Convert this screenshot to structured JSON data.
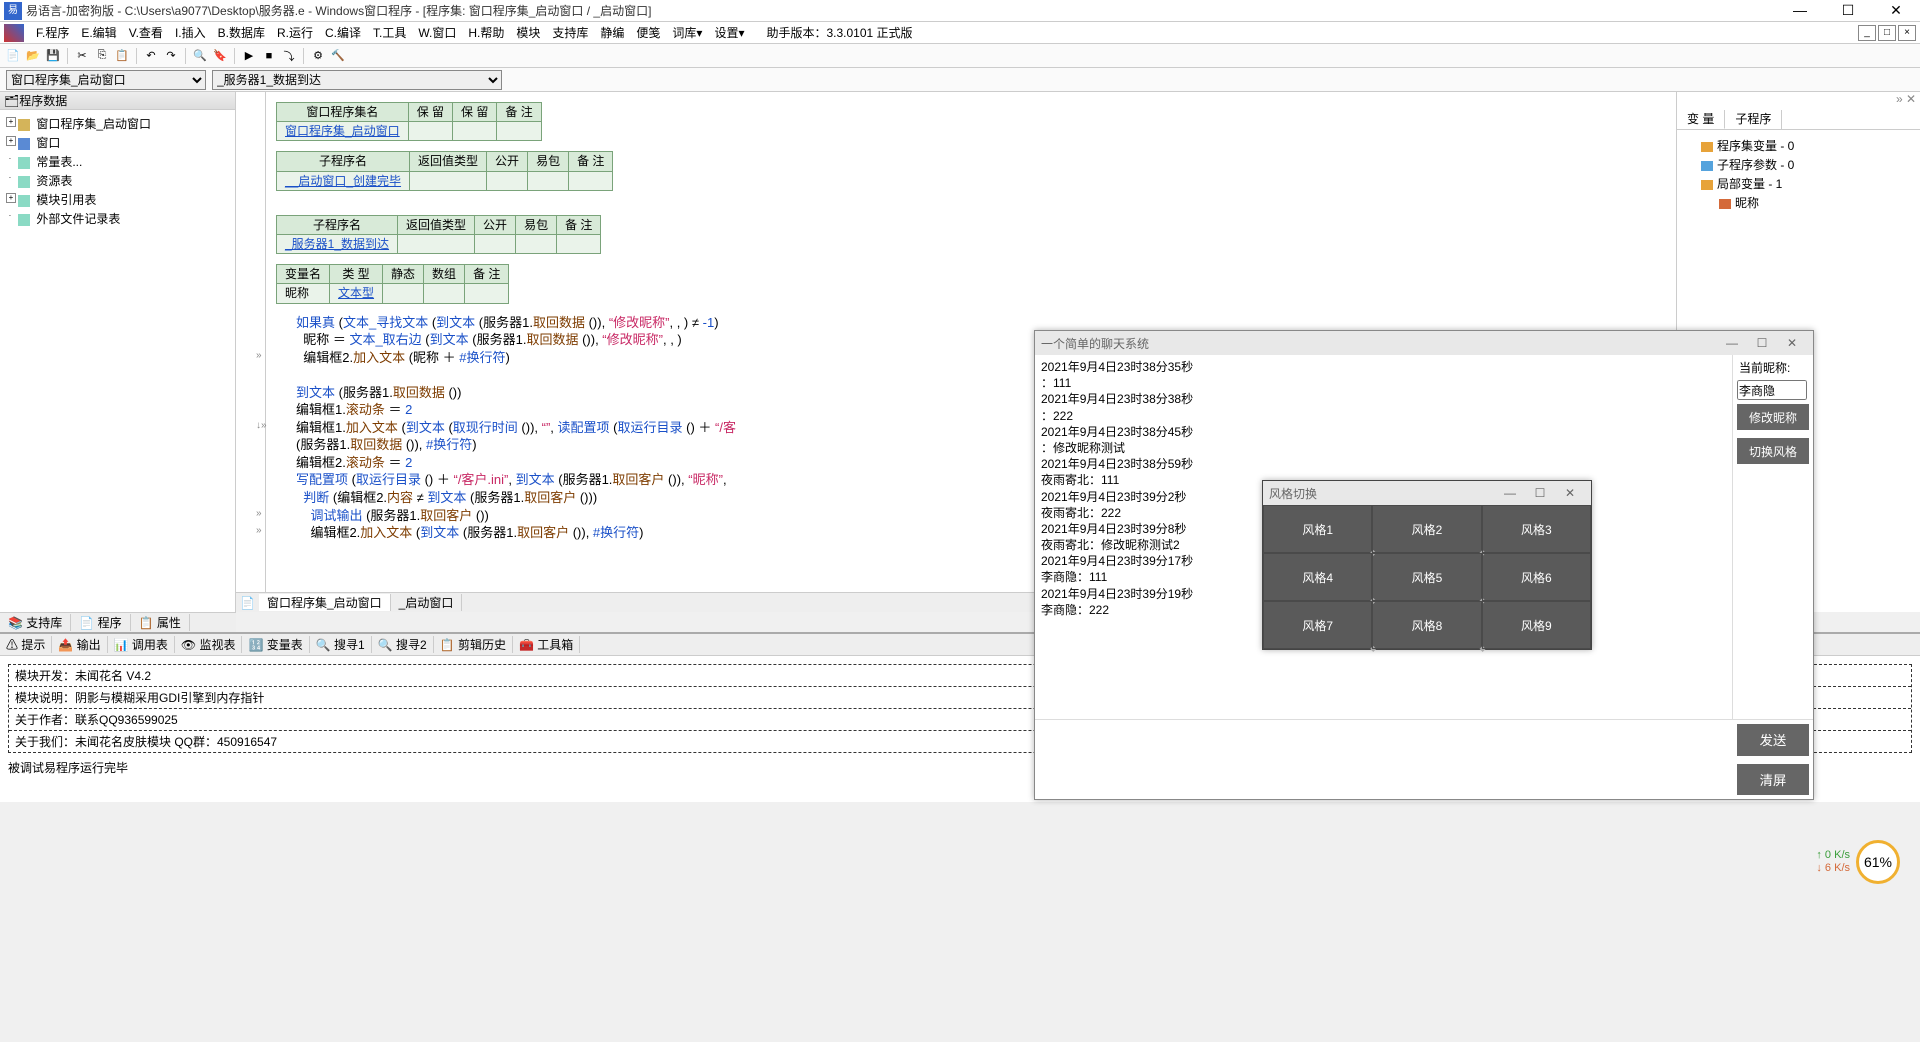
{
  "titlebar": {
    "text": "易语言-加密狗版 - C:\\Users\\a9077\\Desktop\\服务器.e - Windows窗口程序 - [程序集: 窗口程序集_启动窗口 / _启动窗口]"
  },
  "menu": {
    "items": [
      "F.程序",
      "E.编辑",
      "V.查看",
      "I.插入",
      "B.数据库",
      "R.运行",
      "C.编译",
      "T.工具",
      "W.窗口",
      "H.帮助",
      "模块",
      "支持库",
      "静编",
      "便笺",
      "词库▾",
      "设置▾"
    ],
    "helper": "助手版本：3.3.0101 正式版"
  },
  "dropdowns": {
    "d1": "窗口程序集_启动窗口",
    "d2": "_服务器1_数据到达"
  },
  "tree": {
    "title": "程序数据",
    "nodes": [
      {
        "t": "窗口程序集_启动窗口",
        "type": "expand",
        "ico": "folder"
      },
      {
        "t": "窗口",
        "type": "expand",
        "ico": "win"
      },
      {
        "t": "常量表...",
        "type": "leaf",
        "ico": "doc"
      },
      {
        "t": "资源表",
        "type": "leaf",
        "ico": "doc"
      },
      {
        "t": "模块引用表",
        "type": "expand",
        "ico": "doc"
      },
      {
        "t": "外部文件记录表",
        "type": "leaf",
        "ico": "doc"
      }
    ]
  },
  "bl_tabs": [
    "支持库",
    "程序",
    "属性"
  ],
  "editor_tabs": [
    "窗口程序集_启动窗口",
    "_启动窗口"
  ],
  "tables": {
    "t1": {
      "headers": [
        "窗口程序集名",
        "保 留",
        "保 留",
        "备 注"
      ],
      "row": [
        "窗口程序集_启动窗口",
        "",
        "",
        ""
      ]
    },
    "t2": {
      "headers": [
        "子程序名",
        "返回值类型",
        "公开",
        "易包",
        "备 注"
      ],
      "row": [
        "__启动窗口_创建完毕",
        "",
        "",
        "",
        ""
      ]
    },
    "t3": {
      "headers": [
        "子程序名",
        "返回值类型",
        "公开",
        "易包",
        "备 注"
      ],
      "row": [
        "_服务器1_数据到达",
        "",
        "",
        "",
        ""
      ]
    },
    "t4": {
      "headers": [
        "变量名",
        "类 型",
        "静态",
        "数组",
        "备 注"
      ],
      "row": [
        "昵称",
        "文本型",
        "",
        "",
        ""
      ]
    }
  },
  "code": [
    {
      "marker": "",
      "segs": [
        {
          "c": "kw",
          "t": "如果真"
        },
        {
          "c": "punct",
          "t": " ("
        },
        {
          "c": "lit",
          "t": "文本_寻找文本"
        },
        {
          "c": "punct",
          "t": " ("
        },
        {
          "c": "lit",
          "t": "到文本"
        },
        {
          "c": "punct",
          "t": " ("
        },
        {
          "c": "op",
          "t": "服务器1."
        },
        {
          "c": "fn",
          "t": "取回数据"
        },
        {
          "c": "punct",
          "t": " ()), "
        },
        {
          "c": "str",
          "t": "“修改昵称”"
        },
        {
          "c": "punct",
          "t": ", , ) ≠ "
        },
        {
          "c": "lit",
          "t": "-1"
        },
        {
          "c": "punct",
          "t": ")"
        }
      ]
    },
    {
      "marker": "",
      "segs": [
        {
          "c": "op",
          "t": "  昵称 ＝ "
        },
        {
          "c": "lit",
          "t": "文本_取右边"
        },
        {
          "c": "punct",
          "t": " ("
        },
        {
          "c": "lit",
          "t": "到文本"
        },
        {
          "c": "punct",
          "t": " ("
        },
        {
          "c": "op",
          "t": "服务器1."
        },
        {
          "c": "fn",
          "t": "取回数据"
        },
        {
          "c": "punct",
          "t": " ()), "
        },
        {
          "c": "str",
          "t": "“修改昵称”"
        },
        {
          "c": "punct",
          "t": ", , )"
        }
      ]
    },
    {
      "marker": "»",
      "segs": [
        {
          "c": "op",
          "t": "  编辑框2."
        },
        {
          "c": "fn",
          "t": "加入文本"
        },
        {
          "c": "punct",
          "t": " ("
        },
        {
          "c": "op",
          "t": "昵称 ＋ "
        },
        {
          "c": "lit",
          "t": "#换行符"
        },
        {
          "c": "punct",
          "t": ")"
        }
      ]
    },
    {
      "marker": "",
      "segs": [
        {
          "c": "",
          "t": " "
        }
      ]
    },
    {
      "marker": "",
      "segs": [
        {
          "c": "lit",
          "t": "到文本"
        },
        {
          "c": "punct",
          "t": " ("
        },
        {
          "c": "op",
          "t": "服务器1."
        },
        {
          "c": "fn",
          "t": "取回数据"
        },
        {
          "c": "punct",
          "t": " ())"
        }
      ]
    },
    {
      "marker": "",
      "segs": [
        {
          "c": "op",
          "t": "编辑框1."
        },
        {
          "c": "fn",
          "t": "滚动条"
        },
        {
          "c": "op",
          "t": " ＝ "
        },
        {
          "c": "lit",
          "t": "2"
        }
      ]
    },
    {
      "marker": "↓»",
      "segs": [
        {
          "c": "op",
          "t": "编辑框1."
        },
        {
          "c": "fn",
          "t": "加入文本"
        },
        {
          "c": "punct",
          "t": " ("
        },
        {
          "c": "lit",
          "t": "到文本"
        },
        {
          "c": "punct",
          "t": " ("
        },
        {
          "c": "lit",
          "t": "取现行时间"
        },
        {
          "c": "punct",
          "t": " ()), "
        },
        {
          "c": "str",
          "t": "“”"
        },
        {
          "c": "punct",
          "t": ", "
        },
        {
          "c": "lit",
          "t": "读配置项"
        },
        {
          "c": "punct",
          "t": " ("
        },
        {
          "c": "lit",
          "t": "取运行目录"
        },
        {
          "c": "punct",
          "t": " () ＋ "
        },
        {
          "c": "str",
          "t": "“/客"
        }
      ]
    },
    {
      "marker": "",
      "segs": [
        {
          "c": "punct",
          "t": "("
        },
        {
          "c": "op",
          "t": "服务器1."
        },
        {
          "c": "fn",
          "t": "取回数据"
        },
        {
          "c": "punct",
          "t": " ()), "
        },
        {
          "c": "lit",
          "t": "#换行符"
        },
        {
          "c": "punct",
          "t": ")"
        }
      ]
    },
    {
      "marker": "",
      "segs": [
        {
          "c": "op",
          "t": "编辑框2."
        },
        {
          "c": "fn",
          "t": "滚动条"
        },
        {
          "c": "op",
          "t": " ＝ "
        },
        {
          "c": "lit",
          "t": "2"
        }
      ]
    },
    {
      "marker": "",
      "segs": [
        {
          "c": "lit",
          "t": "写配置项"
        },
        {
          "c": "punct",
          "t": " ("
        },
        {
          "c": "lit",
          "t": "取运行目录"
        },
        {
          "c": "punct",
          "t": " () ＋ "
        },
        {
          "c": "str",
          "t": "“/客户.ini”"
        },
        {
          "c": "punct",
          "t": ", "
        },
        {
          "c": "lit",
          "t": "到文本"
        },
        {
          "c": "punct",
          "t": " ("
        },
        {
          "c": "op",
          "t": "服务器1."
        },
        {
          "c": "fn",
          "t": "取回客户"
        },
        {
          "c": "punct",
          "t": " ()), "
        },
        {
          "c": "str",
          "t": "“昵称”"
        },
        {
          "c": "punct",
          "t": ","
        }
      ]
    },
    {
      "marker": "",
      "segs": [
        {
          "c": "kw",
          "t": "  判断"
        },
        {
          "c": "punct",
          "t": " ("
        },
        {
          "c": "op",
          "t": "编辑框2."
        },
        {
          "c": "fn",
          "t": "内容"
        },
        {
          "c": "op",
          "t": " ≠ "
        },
        {
          "c": "lit",
          "t": "到文本"
        },
        {
          "c": "punct",
          "t": " ("
        },
        {
          "c": "op",
          "t": "服务器1."
        },
        {
          "c": "fn",
          "t": "取回客户"
        },
        {
          "c": "punct",
          "t": " ()))"
        }
      ]
    },
    {
      "marker": "»",
      "segs": [
        {
          "c": "kw",
          "t": "    调试输出"
        },
        {
          "c": "punct",
          "t": " ("
        },
        {
          "c": "op",
          "t": "服务器1."
        },
        {
          "c": "fn",
          "t": "取回客户"
        },
        {
          "c": "punct",
          "t": " ())"
        }
      ]
    },
    {
      "marker": "»",
      "segs": [
        {
          "c": "op",
          "t": "    编辑框2."
        },
        {
          "c": "fn",
          "t": "加入文本"
        },
        {
          "c": "punct",
          "t": " ("
        },
        {
          "c": "lit",
          "t": "到文本"
        },
        {
          "c": "punct",
          "t": " ("
        },
        {
          "c": "op",
          "t": "服务器1."
        },
        {
          "c": "fn",
          "t": "取回客户"
        },
        {
          "c": "punct",
          "t": " ()), "
        },
        {
          "c": "lit",
          "t": "#换行符"
        },
        {
          "c": "punct",
          "t": ")"
        }
      ]
    }
  ],
  "vars": {
    "tabs": [
      "变 量",
      "子程序"
    ],
    "items": [
      {
        "t": "程序集变量 - 0",
        "ico": "v-g"
      },
      {
        "t": "子程序参数 - 0",
        "ico": "v-b"
      },
      {
        "t": "局部变量 - 1",
        "ico": "v-g",
        "exp": true
      },
      {
        "t": "昵称",
        "ico": "v-r",
        "indent": true
      }
    ]
  },
  "lower_tabs": [
    "提示",
    "输出",
    "调用表",
    "监视表",
    "变量表",
    "搜寻1",
    "搜寻2",
    "剪辑历史",
    "工具箱"
  ],
  "lower_box": [
    "模块开发：未闻花名        V4.2",
    "模块说明：阴影与模糊采用GDI引擎到内存指针",
    "关于作者：联系QQ936599025",
    "关于我们：未闻花名皮肤模块 QQ群：450916547"
  ],
  "lower_footer": "被调试易程序运行完毕",
  "chat": {
    "title": "一个简单的聊天系统",
    "log": [
      "2021年9月4日23时38分35秒",
      "：111",
      "2021年9月4日23时38分38秒",
      "：222",
      "2021年9月4日23时38分45秒",
      "：修改昵称测试",
      "2021年9月4日23时38分59秒",
      "夜雨寄北：111",
      "2021年9月4日23时39分2秒",
      "夜雨寄北：222",
      "2021年9月4日23时39分8秒",
      "夜雨寄北：修改昵称测试2",
      "2021年9月4日23时39分17秒",
      "李商隐：111",
      "2021年9月4日23时39分19秒",
      "李商隐：222"
    ],
    "side_label": "当前昵称:",
    "nickname": "李商隐",
    "btn_modify": "修改昵称",
    "btn_style": "切换风格",
    "btn_send": "发送",
    "btn_clear": "清屏"
  },
  "style_win": {
    "title": "风格切换",
    "cells": [
      "风格1",
      "风格2",
      "风格3",
      "风格4",
      "风格5",
      "风格6",
      "风格7",
      "风格8",
      "风格9"
    ]
  },
  "netmon": {
    "up": "↑ 0  K/s",
    "dn": "↓ 6  K/s",
    "cpu": "61%"
  }
}
